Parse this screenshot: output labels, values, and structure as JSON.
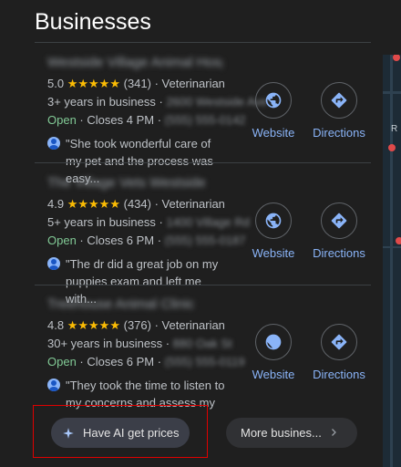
{
  "heading": "Businesses",
  "businesses": [
    {
      "name": "Westside Village Animal Hospital",
      "rating": "5.0",
      "stars": "★★★★★",
      "reviews": "(341)",
      "category": "Veterinarian",
      "years": "3+ years in business",
      "address": "2600 Westside Ave",
      "status": "Open",
      "hours": "Closes 4 PM",
      "phone": "(555) 555-0142",
      "review": "\"She took wonderful care of my pet and the process was easy..."
    },
    {
      "name": "The Village Vets Westside",
      "rating": "4.9",
      "stars": "★★★★★",
      "reviews": "(434)",
      "category": "Veterinarian",
      "years": "5+ years in business",
      "address": "1400 Village Rd",
      "status": "Open",
      "hours": "Closes 6 PM",
      "phone": "(555) 555-0187",
      "review": "\"The dr did a great job on my puppies exam and left me with..."
    },
    {
      "name": "Treehouse Animal Clinic",
      "rating": "4.8",
      "stars": "★★★★★",
      "reviews": "(376)",
      "category": "Veterinarian",
      "years": "30+ years in business",
      "address": "880 Oak St",
      "status": "Open",
      "hours": "Closes 6 PM",
      "phone": "(555) 555-0119",
      "review": "\"They took the time to listen to my concerns and assess my c..."
    }
  ],
  "actions": {
    "website": "Website",
    "directions": "Directions"
  },
  "ai_button": "Have AI get prices",
  "more_button": "More busines...",
  "map": {
    "label": "R"
  },
  "colors": {
    "accent": "#8ab4f8",
    "open": "#81c995",
    "star": "#fbbc04",
    "highlight": "#e00000"
  }
}
